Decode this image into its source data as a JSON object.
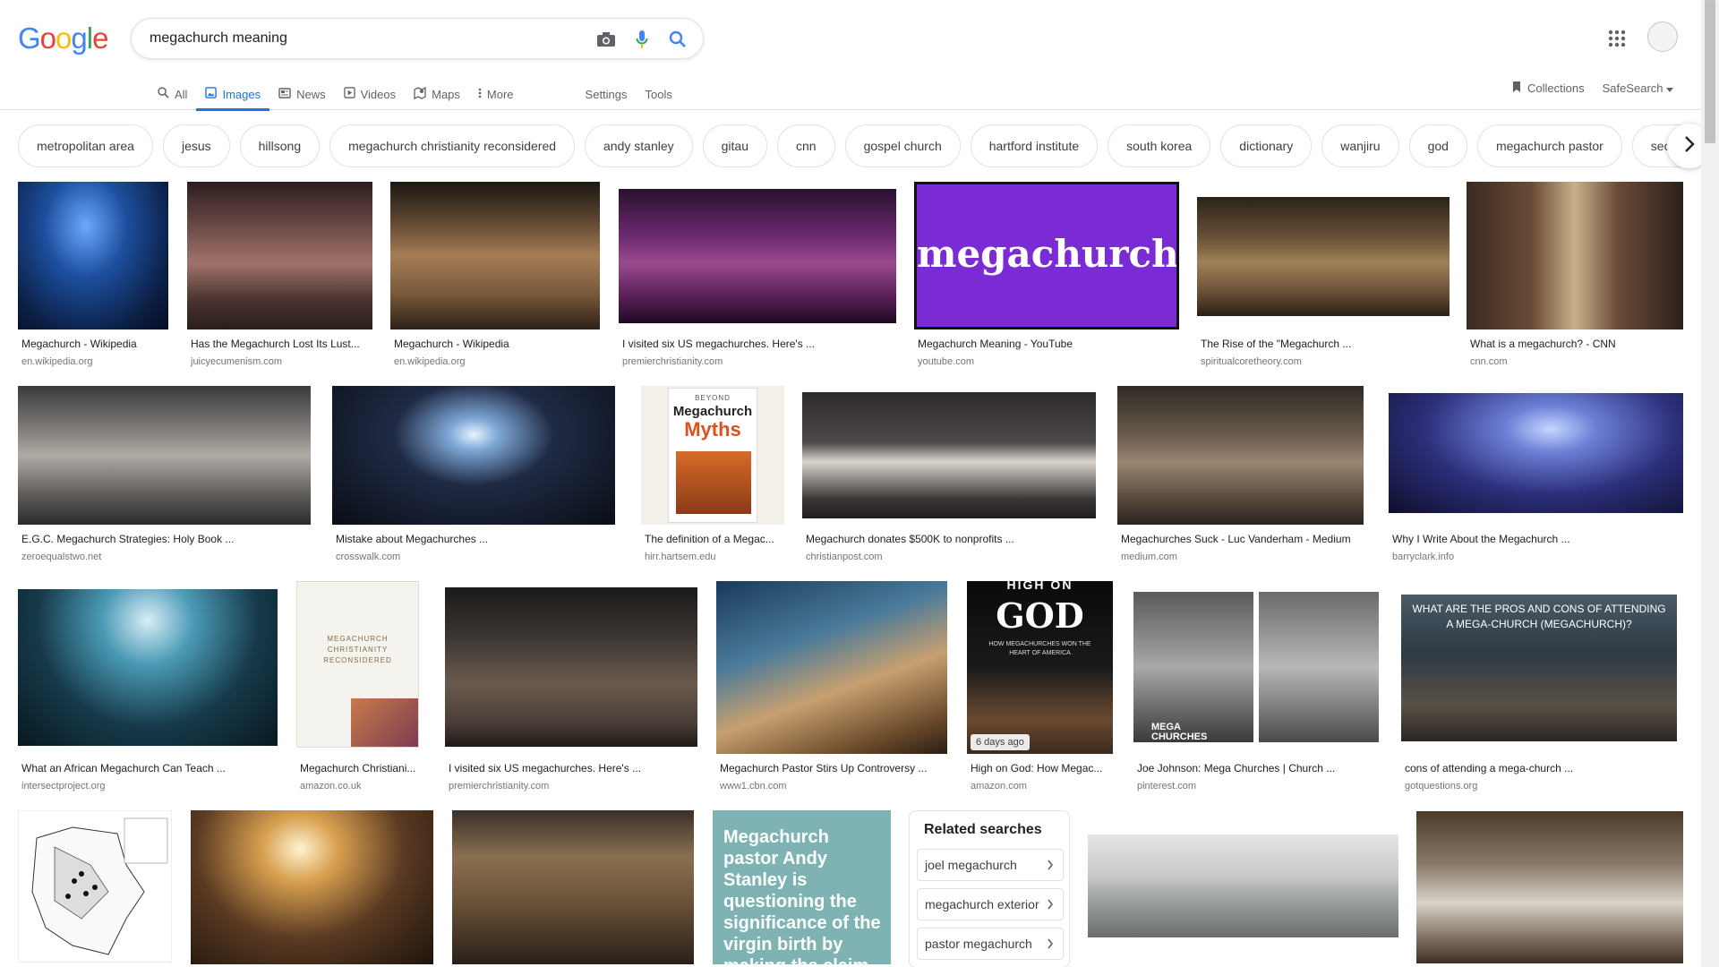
{
  "search": {
    "query": "megachurch meaning"
  },
  "logo": {
    "text": [
      "G",
      "o",
      "o",
      "g",
      "l",
      "e"
    ],
    "colors": [
      "#4285f4",
      "#ea4335",
      "#fbbc05",
      "#4285f4",
      "#34a853",
      "#ea4335"
    ]
  },
  "tabs": [
    {
      "label": "All",
      "icon": "search-icon"
    },
    {
      "label": "Images",
      "icon": "image-icon",
      "active": true
    },
    {
      "label": "News",
      "icon": "news-icon"
    },
    {
      "label": "Videos",
      "icon": "video-icon"
    },
    {
      "label": "Maps",
      "icon": "map-icon"
    },
    {
      "label": "More",
      "icon": "more-vert-icon"
    }
  ],
  "tools": {
    "settings": "Settings",
    "tools": "Tools"
  },
  "right": {
    "collections": "Collections",
    "safesearch": "SafeSearch"
  },
  "chips": [
    "metropolitan area",
    "jesus",
    "hillsong",
    "megachurch christianity reconsidered",
    "andy stanley",
    "gitau",
    "cnn",
    "gospel church",
    "hartford institute",
    "south korea",
    "dictionary",
    "wanjiru",
    "god",
    "megachurch pastor",
    "seoul"
  ],
  "results": {
    "r1": [
      {
        "caption": "Megachurch - Wikipedia",
        "domain": "en.wikipedia.org"
      },
      {
        "caption": "Has the Megachurch Lost Its Lust...",
        "domain": "juicyecumenism.com"
      },
      {
        "caption": "Megachurch - Wikipedia",
        "domain": "en.wikipedia.org"
      },
      {
        "caption": "I visited six US megachurches. Here's ...",
        "domain": "premierchristianity.com"
      },
      {
        "caption": "Megachurch Meaning - YouTube",
        "domain": "youtube.com",
        "overlay": "megachurch"
      },
      {
        "caption": "The Rise of the \"Megachurch ...",
        "domain": "spiritualcoretheory.com"
      },
      {
        "caption": "What is a megachurch? - CNN",
        "domain": "cnn.com"
      }
    ],
    "r2": [
      {
        "caption": "E.G.C. Megachurch Strategies: Holy Book ...",
        "domain": "zeroequalstwo.net"
      },
      {
        "caption": "Mistake about Megachurches ...",
        "domain": "crosswalk.com"
      },
      {
        "caption": "The definition of a Megac...",
        "domain": "hirr.hartsem.edu",
        "book_top": "BEYOND",
        "book_main": "Megachurch",
        "book_accent": "Myths"
      },
      {
        "caption": "Megachurch donates $500K to nonprofits ...",
        "domain": "christianpost.com"
      },
      {
        "caption": "Megachurches Suck - Luc Vanderham - Medium",
        "domain": "medium.com"
      },
      {
        "caption": "Why I Write About the Megachurch ...",
        "domain": "barryclark.info"
      }
    ],
    "r3": [
      {
        "caption": "What an African Megachurch Can Teach ...",
        "domain": "intersectproject.org"
      },
      {
        "caption": "Megachurch Christiani...",
        "domain": "amazon.co.uk",
        "book_lines": [
          "MEGACHURCH",
          "CHRISTIANITY",
          "RECONSIDERED"
        ]
      },
      {
        "caption": "I visited six US megachurches. Here's ...",
        "domain": "premierchristianity.com"
      },
      {
        "caption": "Megachurch Pastor Stirs Up Controversy ...",
        "domain": "www1.cbn.com"
      },
      {
        "caption": "High on God: How Megac...",
        "domain": "amazon.com",
        "badge": "6 days ago",
        "book_high": "HIGH ON",
        "book_god": "GOD",
        "book_sub": "HOW MEGACHURCHES WON THE HEART OF AMERICA"
      },
      {
        "caption": "Joe Johnson: Mega Churches | Church ...",
        "domain": "pinterest.com",
        "overlay": "MEGA CHURCHES"
      },
      {
        "caption": "cons of attending a mega-church ...",
        "domain": "gotquestions.org",
        "overlay": "WHAT ARE THE PROS AND CONS OF ATTENDING A MEGA-CHURCH (MEGACHURCH)?"
      }
    ],
    "r4_cbn": "Megachurch pastor Andy Stanley is questioning the significance of the virgin birth by making the claim t..."
  },
  "related": {
    "title": "Related searches",
    "items": [
      "joel megachurch",
      "megachurch exterior",
      "pastor megachurch"
    ]
  }
}
